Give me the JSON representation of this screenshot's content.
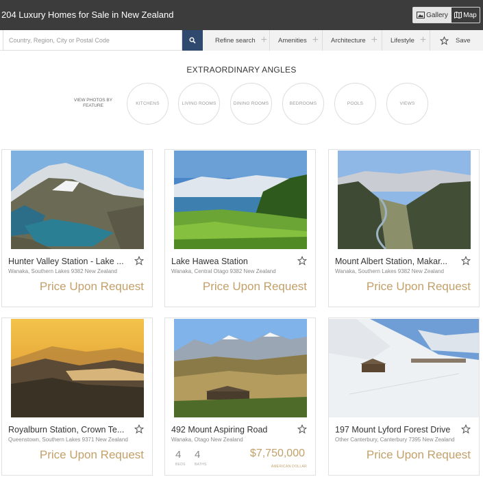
{
  "header": {
    "title": "204 Luxury Homes for Sale in New Zealand",
    "gallery_label": "Gallery",
    "map_label": "Map"
  },
  "search": {
    "placeholder": "Country, Region, City or Postal Code",
    "filters": [
      "Refine search",
      "Amenities",
      "Architecture",
      "Lifestyle"
    ],
    "save_label": "Save"
  },
  "angles": {
    "title": "EXTRAORDINARY ANGLES",
    "view_by": "VIEW PHOTOS BY FEATURE",
    "features": [
      "KITCHENS",
      "LIVING ROOMS",
      "DINING ROOMS",
      "BEDROOMS",
      "POOLS",
      "VIEWS"
    ]
  },
  "listings": [
    {
      "name": "Hunter Valley Station - Lake ...",
      "location": "Wanaka, Southern Lakes 9382 New Zealand",
      "price": "Price Upon Request",
      "photo": "lake-mountain"
    },
    {
      "name": "Lake Hawea Station",
      "location": "Wanaka, Central Otago 9382 New Zealand",
      "price": "Price Upon Request",
      "photo": "green-lake"
    },
    {
      "name": "Mount Albert Station, Makar...",
      "location": "Wanaka, Southern Lakes 9382 New Zealand",
      "price": "Price Upon Request",
      "photo": "valley-river"
    },
    {
      "name": "Royalburn Station, Crown Te...",
      "location": "Queenstown, Southern Lakes 9371 New Zealand",
      "price": "Price Upon Request",
      "photo": "sunset-valley"
    },
    {
      "name": "492 Mount Aspiring Road",
      "location": "Wanaka, Otago New Zealand",
      "price": "$7,750,000",
      "beds": "4",
      "baths": "4",
      "beds_label": "BEDS",
      "baths_label": "BATHS",
      "currency": "AMERICAN DOLLAR",
      "photo": "lodge-hills"
    },
    {
      "name": "197 Mount Lyford Forest Drive",
      "location": "Other Canterbury, Canterbury 7395 New Zealand",
      "price": "Price Upon Request",
      "photo": "snow-lodge"
    }
  ],
  "colors": {
    "topbar": "#3c3c3c",
    "search_button": "#2f4a6e",
    "price_gold": "#c3a069"
  }
}
